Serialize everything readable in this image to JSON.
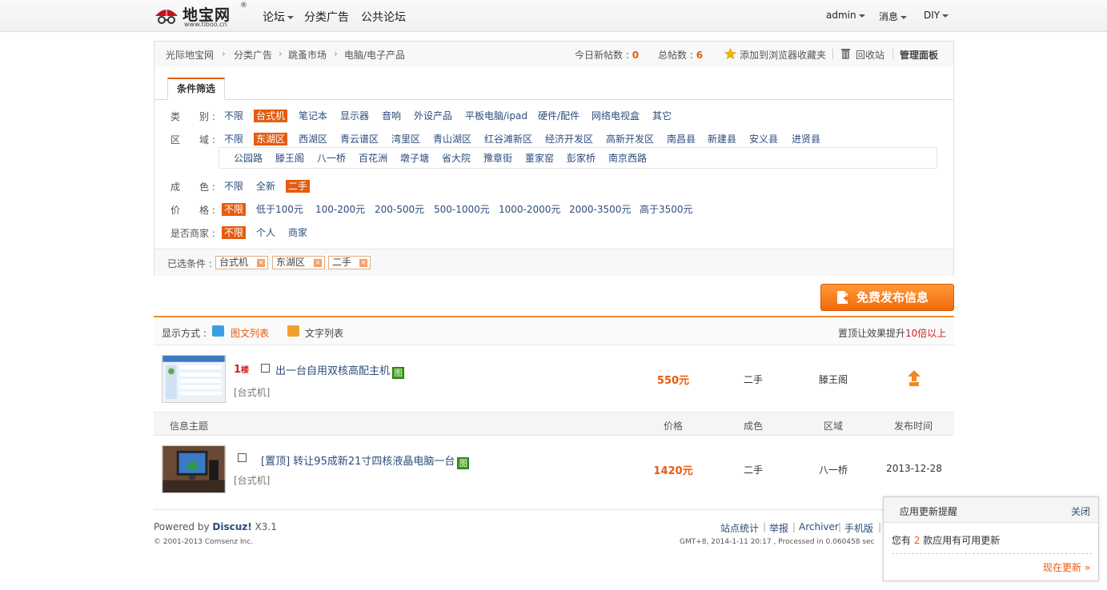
{
  "logo": {
    "name": "地宝网",
    "reg": "®",
    "url": "www.tiboo.cn"
  },
  "topnav": [
    {
      "label": "论坛",
      "has_menu": true
    },
    {
      "label": "分类广告",
      "has_menu": false
    },
    {
      "label": "公共论坛",
      "has_menu": false
    }
  ],
  "usernav": [
    {
      "label": "admin"
    },
    {
      "label": "消息"
    },
    {
      "label": "DIY"
    }
  ],
  "breadcrumb": [
    "光际地宝网",
    "分类广告",
    "跳蚤市场",
    "电脑/电子产品"
  ],
  "breadcrumb_sep": "›",
  "stats": {
    "today_label": "今日新帖数 :",
    "today_value": "0",
    "total_label": "总帖数 :",
    "total_value": "6"
  },
  "tools": {
    "favorite": "添加到浏览器收藏夹",
    "recycle": "回收站",
    "admin_panel": "管理面板"
  },
  "filter_tab": "条件筛选",
  "filters": {
    "category": {
      "label": "类　　别 :",
      "options": [
        "不限",
        "台式机",
        "笔记本",
        "显示器",
        "音响",
        "外设产品",
        "平板电脑/ipad",
        "硬件/配件",
        "网络电视盒",
        "其它"
      ],
      "selected": 1
    },
    "area": {
      "label": "区　　域 :",
      "options": [
        "不限",
        "东湖区",
        "西湖区",
        "青云谱区",
        "湾里区",
        "青山湖区",
        "红谷滩新区",
        "经济开发区",
        "高新开发区",
        "南昌县",
        "新建县",
        "安义县",
        "进贤县"
      ],
      "selected": 1,
      "sub_options": [
        "公园路",
        "滕王阁",
        "八一桥",
        "百花洲",
        "墩子塘",
        "省大院",
        "豫章街",
        "董家窑",
        "彭家桥",
        "南京西路"
      ]
    },
    "condition": {
      "label": "成　　色 :",
      "options": [
        "不限",
        "全新",
        "二手"
      ],
      "selected": 2
    },
    "price": {
      "label": "价　　格 :",
      "options": [
        "不限",
        "低于100元",
        "100-200元",
        "200-500元",
        "500-1000元",
        "1000-2000元",
        "2000-3500元",
        "高于3500元"
      ],
      "selected": 0
    },
    "merchant": {
      "label": "是否商家 :",
      "options": [
        "不限",
        "个人",
        "商家"
      ],
      "selected": 0
    }
  },
  "selected_conditions": {
    "label": "已选条件 :",
    "tags": [
      "台式机",
      "东湖区",
      "二手"
    ],
    "remove_glyph": "×"
  },
  "publish_button": "免费发布信息",
  "view_mode": {
    "label": "显示方式 :",
    "image_list": "图文列表",
    "text_list": "文字列表",
    "promo_prefix": "置顶让效果提升",
    "promo_highlight": "10倍以上"
  },
  "listings": [
    {
      "floor": "1",
      "floor_unit": "楼",
      "title": "出一台自用双核高配主机",
      "has_pic": true,
      "pic_badge": "图",
      "category": "[台式机]",
      "price": "550元",
      "condition": "二手",
      "area": "滕王阁",
      "date": "",
      "has_top_icon": true
    },
    {
      "sticky": "[置顶]",
      "title": "转让95成新21寸四核液晶电脑一台",
      "has_pic": true,
      "pic_badge": "图",
      "category": "[台式机]",
      "price": "1420元",
      "condition": "二手",
      "area": "八一桥",
      "date": "2013-12-28"
    }
  ],
  "columns": [
    "信息主题",
    "价格",
    "成色",
    "区域",
    "发布时间"
  ],
  "footer": {
    "powered_prefix": "Powered by ",
    "powered_brand": "Discuz!",
    "powered_version": " X3.1",
    "copyright": "© 2001-2013 Comsenz Inc.",
    "links": [
      "站点统计",
      "举报",
      "Archiver",
      "手机版"
    ],
    "time_info": "GMT+8, 2014-1-11 20:17 , Processed in 0.060458 sec"
  },
  "popup": {
    "title": "应用更新提醒",
    "close": "关闭",
    "msg_prefix": "您有 ",
    "count": "2",
    "msg_suffix": " 款应用有可用更新",
    "action": "现在更新 »"
  },
  "colors": {
    "accent": "#e65b10",
    "link": "#2c4c7c",
    "green_badge": "#3a9a1a"
  }
}
